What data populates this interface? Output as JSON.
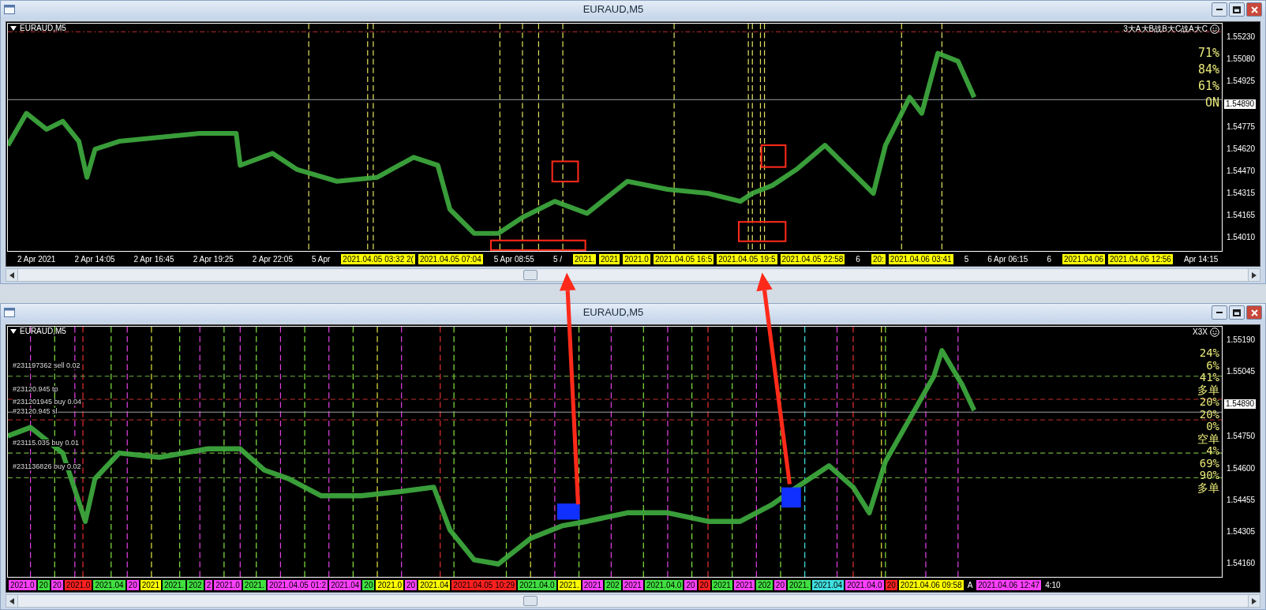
{
  "windows": [
    {
      "title": "EURAUD,M5",
      "chart_label": "EURAUD,M5",
      "header_right": "3大A大B战B大C战A大C",
      "indicator_texts": [
        "71%",
        "84%",
        "61%",
        "ON"
      ],
      "price_ticks": [
        {
          "text": "1.55230",
          "kind": "tick"
        },
        {
          "text": "1.55080",
          "kind": "tick"
        },
        {
          "text": "1.54925",
          "kind": "tick"
        },
        {
          "text": "1.54890",
          "kind": "current"
        },
        {
          "text": "1.54775",
          "kind": "tick"
        },
        {
          "text": "1.54620",
          "kind": "tick"
        },
        {
          "text": "1.54470",
          "kind": "tick"
        },
        {
          "text": "1.54315",
          "kind": "tick"
        },
        {
          "text": "1.54165",
          "kind": "tick"
        },
        {
          "text": "1.54010",
          "kind": "tick"
        }
      ],
      "time_axis": [
        {
          "text": "2 Apr 2021",
          "kind": "tick"
        },
        {
          "text": "2 Apr 14:05",
          "kind": "tick"
        },
        {
          "text": "2 Apr 16:45",
          "kind": "tick"
        },
        {
          "text": "2 Apr 19:25",
          "kind": "tick"
        },
        {
          "text": "2 Apr 22:05",
          "kind": "tick"
        },
        {
          "text": "5 Apr",
          "kind": "tick"
        },
        {
          "text": "2021.04.05 03:32 2(",
          "kind": "marker",
          "color": "#ffff00"
        },
        {
          "text": "2021.04.05 07:04",
          "kind": "marker",
          "color": "#ffff00"
        },
        {
          "text": "5 Apr 08:55",
          "kind": "tick"
        },
        {
          "text": "5 /",
          "kind": "tick"
        },
        {
          "text": "2021.",
          "kind": "marker",
          "color": "#ffff00"
        },
        {
          "text": "2021",
          "kind": "marker",
          "color": "#ffff00"
        },
        {
          "text": "2021.0",
          "kind": "marker",
          "color": "#ffff00"
        },
        {
          "text": "2021.04.05 16:5",
          "kind": "marker",
          "color": "#ffff00"
        },
        {
          "text": "2021.04.05 19:5",
          "kind": "marker",
          "color": "#ffff00"
        },
        {
          "text": "2021.04.05 22:58",
          "kind": "marker",
          "color": "#ffff00"
        },
        {
          "text": "6",
          "kind": "tick"
        },
        {
          "text": "20:",
          "kind": "marker",
          "color": "#ffff00"
        },
        {
          "text": "2021.04.06 03:41",
          "kind": "marker",
          "color": "#ffff00"
        },
        {
          "text": "5",
          "kind": "tick"
        },
        {
          "text": "6 Apr 06:15",
          "kind": "tick"
        },
        {
          "text": "6",
          "kind": "tick"
        },
        {
          "text": "2021.04.06",
          "kind": "marker",
          "color": "#ffff00"
        },
        {
          "text": "2021.04.06 12:56",
          "kind": "marker",
          "color": "#ffff00"
        },
        {
          "text": "Apr 14:15",
          "kind": "tick"
        }
      ]
    },
    {
      "title": "EURAUD,M5",
      "chart_label": "EURAUD,M5",
      "header_right": "X3X",
      "indicator_texts": [
        "24%",
        "6%",
        "41%",
        "多单",
        "20%",
        "20%",
        "0%",
        "空单",
        "4%",
        "69%",
        "90%",
        "多单"
      ],
      "order_labels": [
        "#231197362 sell 0.02",
        "#23120.945 tp",
        "#231201945 buy 0.04",
        "#23120.945 sl",
        "#23115.035 buy 0.01",
        "#231136826 buy 0.02"
      ],
      "price_ticks": [
        {
          "text": "1.55190",
          "kind": "tick"
        },
        {
          "text": "1.55045",
          "kind": "tick"
        },
        {
          "text": "1.54890",
          "kind": "current"
        },
        {
          "text": "1.54750",
          "kind": "tick"
        },
        {
          "text": "1.54600",
          "kind": "tick"
        },
        {
          "text": "1.54455",
          "kind": "tick"
        },
        {
          "text": "1.54305",
          "kind": "tick"
        },
        {
          "text": "1.54160",
          "kind": "tick"
        }
      ],
      "time_axis": [
        {
          "text": "2021.0",
          "kind": "marker",
          "color": "#ff40ff"
        },
        {
          "text": "20",
          "kind": "marker",
          "color": "#40e040"
        },
        {
          "text": "20",
          "kind": "marker",
          "color": "#ff40ff"
        },
        {
          "text": "2021.0",
          "kind": "marker",
          "color": "#ff2020"
        },
        {
          "text": "2021.04",
          "kind": "marker",
          "color": "#40e040"
        },
        {
          "text": "20",
          "kind": "marker",
          "color": "#ff40ff"
        },
        {
          "text": "2021",
          "kind": "marker",
          "color": "#ffff00"
        },
        {
          "text": "2021.",
          "kind": "marker",
          "color": "#40e040"
        },
        {
          "text": "202",
          "kind": "marker",
          "color": "#40e040"
        },
        {
          "text": "2",
          "kind": "marker",
          "color": "#ff40ff"
        },
        {
          "text": "2021.0",
          "kind": "marker",
          "color": "#ff40ff"
        },
        {
          "text": "2021.",
          "kind": "marker",
          "color": "#40e040"
        },
        {
          "text": "2021.04.05 01:2",
          "kind": "marker",
          "color": "#ff40ff"
        },
        {
          "text": "2021.04",
          "kind": "marker",
          "color": "#ff40ff"
        },
        {
          "text": "20",
          "kind": "marker",
          "color": "#40e040"
        },
        {
          "text": "2021.0",
          "kind": "marker",
          "color": "#ffff00"
        },
        {
          "text": "20",
          "kind": "marker",
          "color": "#ff40ff"
        },
        {
          "text": "2021.04",
          "kind": "marker",
          "color": "#ffff00"
        },
        {
          "text": "2021.04.05 10:29",
          "kind": "marker",
          "color": "#ff2020"
        },
        {
          "text": "2021.04.0",
          "kind": "marker",
          "color": "#40e040"
        },
        {
          "text": "2021.",
          "kind": "marker",
          "color": "#ffff00"
        },
        {
          "text": "2021",
          "kind": "marker",
          "color": "#ff40ff"
        },
        {
          "text": "202",
          "kind": "marker",
          "color": "#40e040"
        },
        {
          "text": "2021",
          "kind": "marker",
          "color": "#ff40ff"
        },
        {
          "text": "2021.04.0",
          "kind": "marker",
          "color": "#40e040"
        },
        {
          "text": "20",
          "kind": "marker",
          "color": "#ff40ff"
        },
        {
          "text": "20",
          "kind": "marker",
          "color": "#ff2020"
        },
        {
          "text": "2021",
          "kind": "marker",
          "color": "#40e040"
        },
        {
          "text": "2021",
          "kind": "marker",
          "color": "#ff40ff"
        },
        {
          "text": "202",
          "kind": "marker",
          "color": "#40e040"
        },
        {
          "text": "20",
          "kind": "marker",
          "color": "#ff40ff"
        },
        {
          "text": "2021.",
          "kind": "marker",
          "color": "#40e040"
        },
        {
          "text": "2021.04",
          "kind": "marker",
          "color": "#40e0e0"
        },
        {
          "text": "2021.04.0",
          "kind": "marker",
          "color": "#ff40ff"
        },
        {
          "text": "20",
          "kind": "marker",
          "color": "#ff2020"
        },
        {
          "text": "2021.04.06 09:58",
          "kind": "marker",
          "color": "#ffff00"
        },
        {
          "text": "A",
          "kind": "tick"
        },
        {
          "text": "2021.04.06 12:47",
          "kind": "marker",
          "color": "#ff40ff"
        },
        {
          "text": "4:10",
          "kind": "tick"
        }
      ]
    }
  ]
}
